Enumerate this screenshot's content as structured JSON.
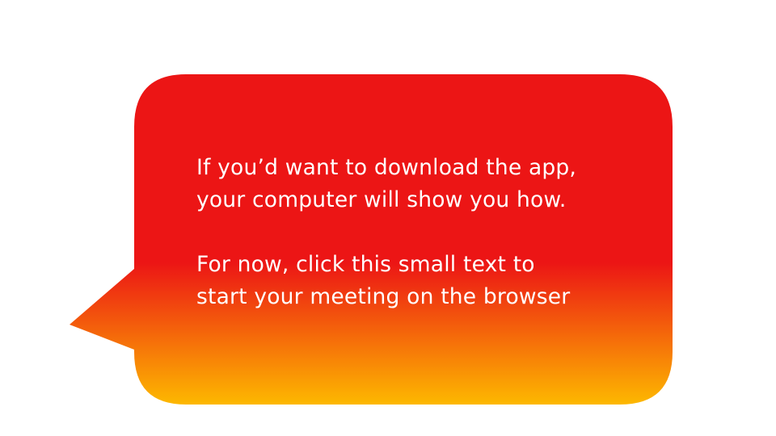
{
  "bubble": {
    "colors": {
      "top": "#ec1515",
      "middle": "#ec1515",
      "bottom": "#fdb800"
    },
    "paragraph_1": {
      "line_1": "If you’d want to download the app,",
      "line_2": "your computer will show you how."
    },
    "paragraph_2": {
      "line_1": "For now, click this small text to",
      "line_2": "start your meeting on the browser"
    }
  }
}
